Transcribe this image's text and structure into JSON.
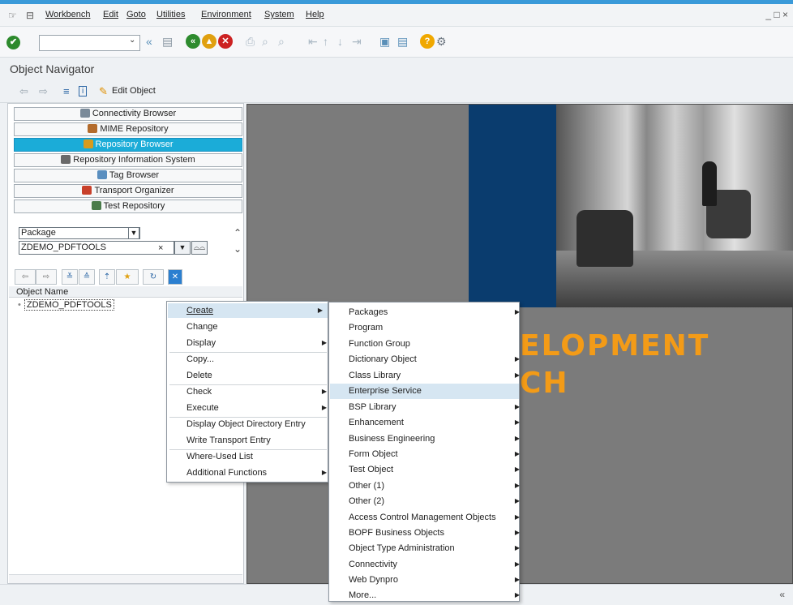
{
  "menubar": {
    "items": [
      "Workbench",
      "Edit",
      "Goto",
      "Utilities",
      "Environment",
      "System",
      "Help"
    ],
    "window_controls": "_ □ ×"
  },
  "toolbar": {
    "command_value": ""
  },
  "title": "Object Navigator",
  "app_toolbar": {
    "edit_object_label": "Edit Object"
  },
  "left": {
    "nav_buttons": [
      {
        "label": "Connectivity Browser",
        "icon": "connectivity-icon",
        "selected": false
      },
      {
        "label": "MIME Repository",
        "icon": "mime-icon",
        "selected": false
      },
      {
        "label": "Repository Browser",
        "icon": "repository-icon",
        "selected": true
      },
      {
        "label": "Repository Information System",
        "icon": "info-system-icon",
        "selected": false
      },
      {
        "label": "Tag Browser",
        "icon": "tag-icon",
        "selected": false
      },
      {
        "label": "Transport Organizer",
        "icon": "transport-icon",
        "selected": false
      },
      {
        "label": "Test Repository",
        "icon": "test-icon",
        "selected": false
      }
    ],
    "object_type": "Package",
    "object_value": "ZDEMO_PDFTOOLS",
    "column_header": "Object Name",
    "tree_items": [
      "ZDEMO_PDFTOOLS"
    ]
  },
  "banner": {
    "line1": "ELOPMENT",
    "line2": "CH",
    "colors": {
      "blue": "#0a3c6e",
      "orange": "#f39b17",
      "gray": "#7b7b7b"
    }
  },
  "context_menu": {
    "items": [
      {
        "label": "Create",
        "submenu": true,
        "highlight": true
      },
      {
        "label": "Change",
        "submenu": false
      },
      {
        "label": "Display",
        "submenu": true
      },
      {
        "label": "Copy...",
        "submenu": false
      },
      {
        "label": "Delete",
        "submenu": false
      },
      {
        "label": "Check",
        "submenu": true
      },
      {
        "label": "Execute",
        "submenu": true
      },
      {
        "label": "Display Object Directory Entry",
        "submenu": false
      },
      {
        "label": "Write Transport Entry",
        "submenu": false
      },
      {
        "label": "Where-Used List",
        "submenu": false
      },
      {
        "label": "Additional Functions",
        "submenu": true
      }
    ]
  },
  "create_submenu": {
    "items": [
      {
        "label": "Packages",
        "submenu": true
      },
      {
        "label": "Program",
        "submenu": false
      },
      {
        "label": "Function Group",
        "submenu": false
      },
      {
        "label": "Dictionary Object",
        "submenu": true
      },
      {
        "label": "Class Library",
        "submenu": true
      },
      {
        "label": "Enterprise Service",
        "submenu": false,
        "highlight": true
      },
      {
        "label": "BSP Library",
        "submenu": true
      },
      {
        "label": "Enhancement",
        "submenu": true
      },
      {
        "label": "Business Engineering",
        "submenu": true
      },
      {
        "label": "Form Object",
        "submenu": true
      },
      {
        "label": "Test Object",
        "submenu": true
      },
      {
        "label": "Other (1)",
        "submenu": true
      },
      {
        "label": "Other (2)",
        "submenu": true
      },
      {
        "label": "Access Control Management Objects",
        "submenu": true
      },
      {
        "label": "BOPF Business Objects",
        "submenu": true
      },
      {
        "label": "Object Type Administration",
        "submenu": true
      },
      {
        "label": "Connectivity",
        "submenu": true
      },
      {
        "label": "Web Dynpro",
        "submenu": true
      },
      {
        "label": "More...",
        "submenu": true
      }
    ]
  },
  "status": {
    "right": "«"
  }
}
